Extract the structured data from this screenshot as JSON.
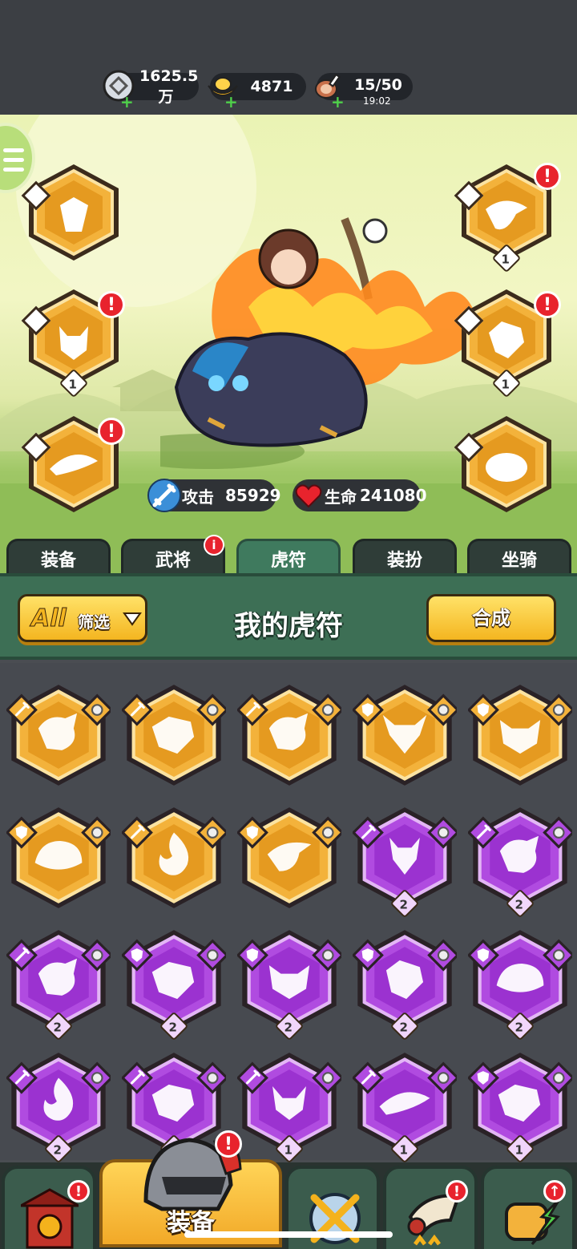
{
  "resources": {
    "silver": {
      "icon": "silver-coin-icon",
      "value": "1625.5万"
    },
    "gold": {
      "icon": "gold-ingot-icon",
      "value": "4871"
    },
    "stamina": {
      "icon": "meat-leg-icon",
      "value": "15/50",
      "timer": "19:02"
    }
  },
  "stats": {
    "attack": {
      "label": "攻击",
      "value": "85929",
      "icon": "sword-icon"
    },
    "hp": {
      "label": "生命",
      "value": "241080",
      "icon": "heart-icon"
    }
  },
  "equipped_slots": [
    {
      "side": "left",
      "row": 0,
      "beast": "deer",
      "type": "sword",
      "level": "",
      "alert": false
    },
    {
      "side": "left",
      "row": 1,
      "beast": "fox",
      "type": "sword",
      "level": "1",
      "alert": true,
      "alert_text": "!"
    },
    {
      "side": "left",
      "row": 2,
      "beast": "whale",
      "type": "sword",
      "level": "",
      "alert": true,
      "alert_text": "!"
    },
    {
      "side": "right",
      "row": 0,
      "beast": "phoenix",
      "type": "shield",
      "level": "1",
      "alert": true,
      "alert_text": "!"
    },
    {
      "side": "right",
      "row": 1,
      "beast": "wolf",
      "type": "shield",
      "level": "1",
      "alert": true,
      "alert_text": "!"
    },
    {
      "side": "right",
      "row": 2,
      "beast": "boar",
      "type": "shield",
      "level": "",
      "alert": false
    }
  ],
  "tabs": [
    {
      "label": "装备",
      "active": false,
      "badge": ""
    },
    {
      "label": "武将",
      "active": false,
      "badge": "i"
    },
    {
      "label": "虎符",
      "active": true,
      "badge": ""
    },
    {
      "label": "装扮",
      "active": false,
      "badge": ""
    },
    {
      "label": "坐骑",
      "active": false,
      "badge": ""
    }
  ],
  "header": {
    "filter_all": "All",
    "filter_label": "筛选",
    "title": "我的虎符",
    "combine_button": "合成"
  },
  "inventory": [
    {
      "rarity": "orange",
      "type": "sword",
      "beast": "dragon",
      "level": ""
    },
    {
      "rarity": "orange",
      "type": "sword",
      "beast": "tiger",
      "level": ""
    },
    {
      "rarity": "orange",
      "type": "sword",
      "beast": "dragon",
      "level": ""
    },
    {
      "rarity": "orange",
      "type": "shield",
      "beast": "bull",
      "level": ""
    },
    {
      "rarity": "orange",
      "type": "shield",
      "beast": "demon-mask",
      "level": ""
    },
    {
      "rarity": "orange",
      "type": "shield",
      "beast": "tortoise",
      "level": ""
    },
    {
      "rarity": "orange",
      "type": "sword",
      "beast": "flame",
      "level": ""
    },
    {
      "rarity": "orange",
      "type": "shield",
      "beast": "bird",
      "level": ""
    },
    {
      "rarity": "purple",
      "type": "sword",
      "beast": "deer",
      "level": "2"
    },
    {
      "rarity": "purple",
      "type": "sword",
      "beast": "dragon",
      "level": "2"
    },
    {
      "rarity": "purple",
      "type": "sword",
      "beast": "dragon",
      "level": "2"
    },
    {
      "rarity": "purple",
      "type": "shield",
      "beast": "tiger",
      "level": "2"
    },
    {
      "rarity": "purple",
      "type": "shield",
      "beast": "demon-mask",
      "level": "2"
    },
    {
      "rarity": "purple",
      "type": "shield",
      "beast": "wolf",
      "level": "2"
    },
    {
      "rarity": "purple",
      "type": "shield",
      "beast": "tortoise",
      "level": "2"
    },
    {
      "rarity": "purple",
      "type": "sword",
      "beast": "flame",
      "level": "2"
    },
    {
      "rarity": "purple",
      "type": "sword",
      "beast": "tiger",
      "level": "1"
    },
    {
      "rarity": "purple",
      "type": "sword",
      "beast": "fox",
      "level": "1"
    },
    {
      "rarity": "purple",
      "type": "sword",
      "beast": "whale",
      "level": "1"
    },
    {
      "rarity": "purple",
      "type": "shield",
      "beast": "tiger",
      "level": "1"
    }
  ],
  "bottom_nav": [
    {
      "name": "gate",
      "label": "",
      "active": false,
      "badge": "!"
    },
    {
      "name": "equipment",
      "label": "装备",
      "active": true,
      "badge": "!"
    },
    {
      "name": "battle",
      "label": "",
      "active": false,
      "badge": ""
    },
    {
      "name": "horn",
      "label": "",
      "active": false,
      "badge": "!"
    },
    {
      "name": "upgrade",
      "label": "",
      "active": false,
      "badge": "↑"
    }
  ],
  "colors": {
    "orange_fill": "#f3b23b",
    "orange_inner": "#e59a20",
    "orange_edge": "#fbe3a2",
    "purple_fill": "#b04be0",
    "purple_inner": "#9b32d0",
    "purple_edge": "#e3b6f5",
    "alert": "#e8232d",
    "tab_active": "#3f7a5e"
  }
}
